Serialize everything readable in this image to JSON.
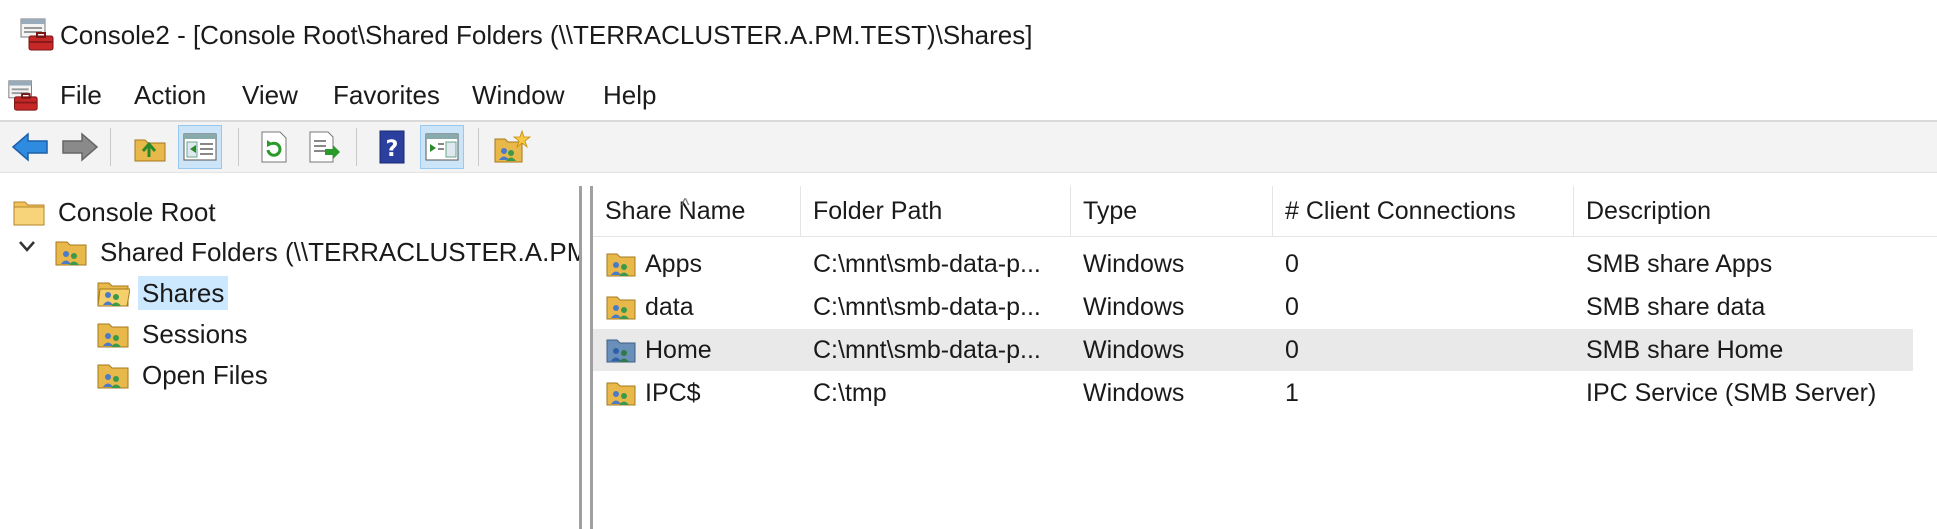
{
  "window": {
    "title": "Console2 - [Console Root\\Shared Folders (\\\\TERRACLUSTER.A.PM.TEST)\\Shares]"
  },
  "menu": [
    "File",
    "Action",
    "View",
    "Favorites",
    "Window",
    "Help"
  ],
  "toolbar": {
    "buttons": [
      {
        "name": "back-button",
        "icon": "back-arrow-icon"
      },
      {
        "name": "forward-button",
        "icon": "forward-arrow-icon"
      },
      {
        "name": "up-one-level-button",
        "icon": "up-folder-icon"
      },
      {
        "name": "show-hide-tree-button",
        "icon": "console-tree-icon"
      },
      {
        "name": "refresh-button",
        "icon": "refresh-icon"
      },
      {
        "name": "export-list-button",
        "icon": "export-icon"
      },
      {
        "name": "help-button",
        "icon": "help-icon"
      },
      {
        "name": "show-hide-action-pane-button",
        "icon": "action-pane-icon"
      },
      {
        "name": "new-share-button",
        "icon": "new-share-icon"
      }
    ]
  },
  "tree": {
    "root": "Console Root",
    "shared_folders": "Shared Folders (\\\\TERRACLUSTER.A.PM.TEST)",
    "children": [
      "Shares",
      "Sessions",
      "Open Files"
    ],
    "selected": "Shares"
  },
  "list": {
    "columns": [
      "Share Name",
      "Folder Path",
      "Type",
      "# Client Connections",
      "Description"
    ],
    "sort_indicator": "^",
    "rows": [
      {
        "name": "Apps",
        "path": "C:\\mnt\\smb-data-p...",
        "type": "Windows",
        "connections": "0",
        "description": "SMB share Apps"
      },
      {
        "name": "data",
        "path": "C:\\mnt\\smb-data-p...",
        "type": "Windows",
        "connections": "0",
        "description": "SMB share data"
      },
      {
        "name": "Home",
        "path": "C:\\mnt\\smb-data-p...",
        "type": "Windows",
        "connections": "0",
        "description": "SMB share Home"
      },
      {
        "name": "IPC$",
        "path": "C:\\tmp",
        "type": "Windows",
        "connections": "1",
        "description": "IPC Service (SMB Server)"
      }
    ]
  },
  "colors": {
    "selection": "#cce8ff",
    "hover_row": "#e9e9e9",
    "toolbar_bg": "#f3f3f3",
    "pressed": "#cce4f7"
  }
}
